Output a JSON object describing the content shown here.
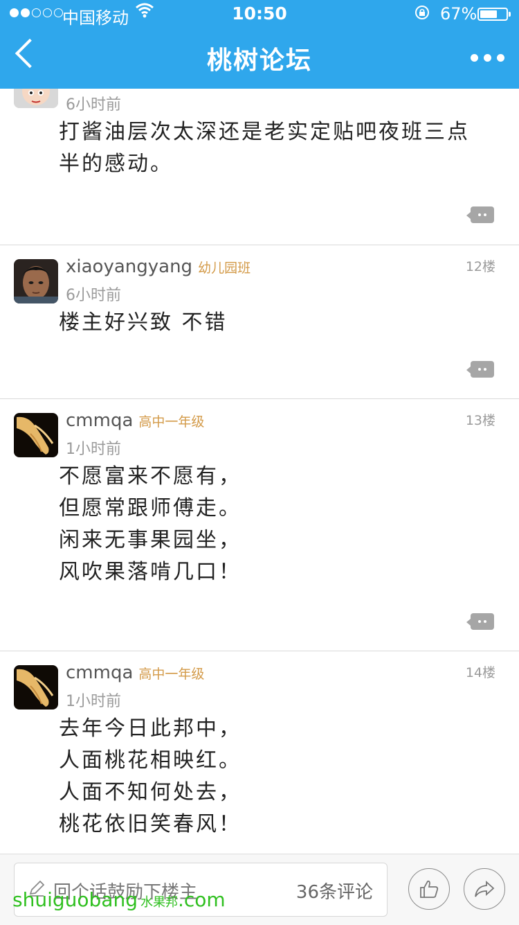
{
  "status_bar": {
    "carrier": "中国移动",
    "time": "10:50",
    "battery_pct": "67%",
    "battery_level": 0.67,
    "signal_bars_on": 2,
    "signal_bars_total": 5
  },
  "nav": {
    "back_icon": "chevron-left-icon",
    "title": "桃树论坛",
    "more_icon": "more-dots-icon"
  },
  "posts": [
    {
      "user": "",
      "badge": "",
      "floor": "",
      "time": "6小时前",
      "text": "打酱油层次太深还是老实定贴吧夜班三点半的感动。"
    },
    {
      "user": "xiaoyangyang",
      "badge": "幼儿园班",
      "floor": "12楼",
      "time": "6小时前",
      "text": "楼主好兴致 不错"
    },
    {
      "user": "cmmqa",
      "badge": "高中一年级",
      "floor": "13楼",
      "time": "1小时前",
      "text": "不愿富来不愿有，\n但愿常跟师傅走。\n闲来无事果园坐，\n风吹果落啃几口！"
    },
    {
      "user": "cmmqa",
      "badge": "高中一年级",
      "floor": "14楼",
      "time": "1小时前",
      "text": "去年今日此邦中，\n人面桃花相映红。\n人面不知何处去，\n桃花依旧笑春风！"
    }
  ],
  "bottom_bar": {
    "reply_placeholder": "回个话鼓励下楼主",
    "comment_count": "36条评论",
    "like_icon": "thumbs-up-icon",
    "share_icon": "share-icon"
  },
  "watermark": {
    "text": "shuiguobang",
    "sub": "水果邦",
    "suffix": ".com"
  },
  "colors": {
    "nav_bg": "#2fa7ec",
    "badge": "#d39a48",
    "muted": "#9a9a9a"
  }
}
